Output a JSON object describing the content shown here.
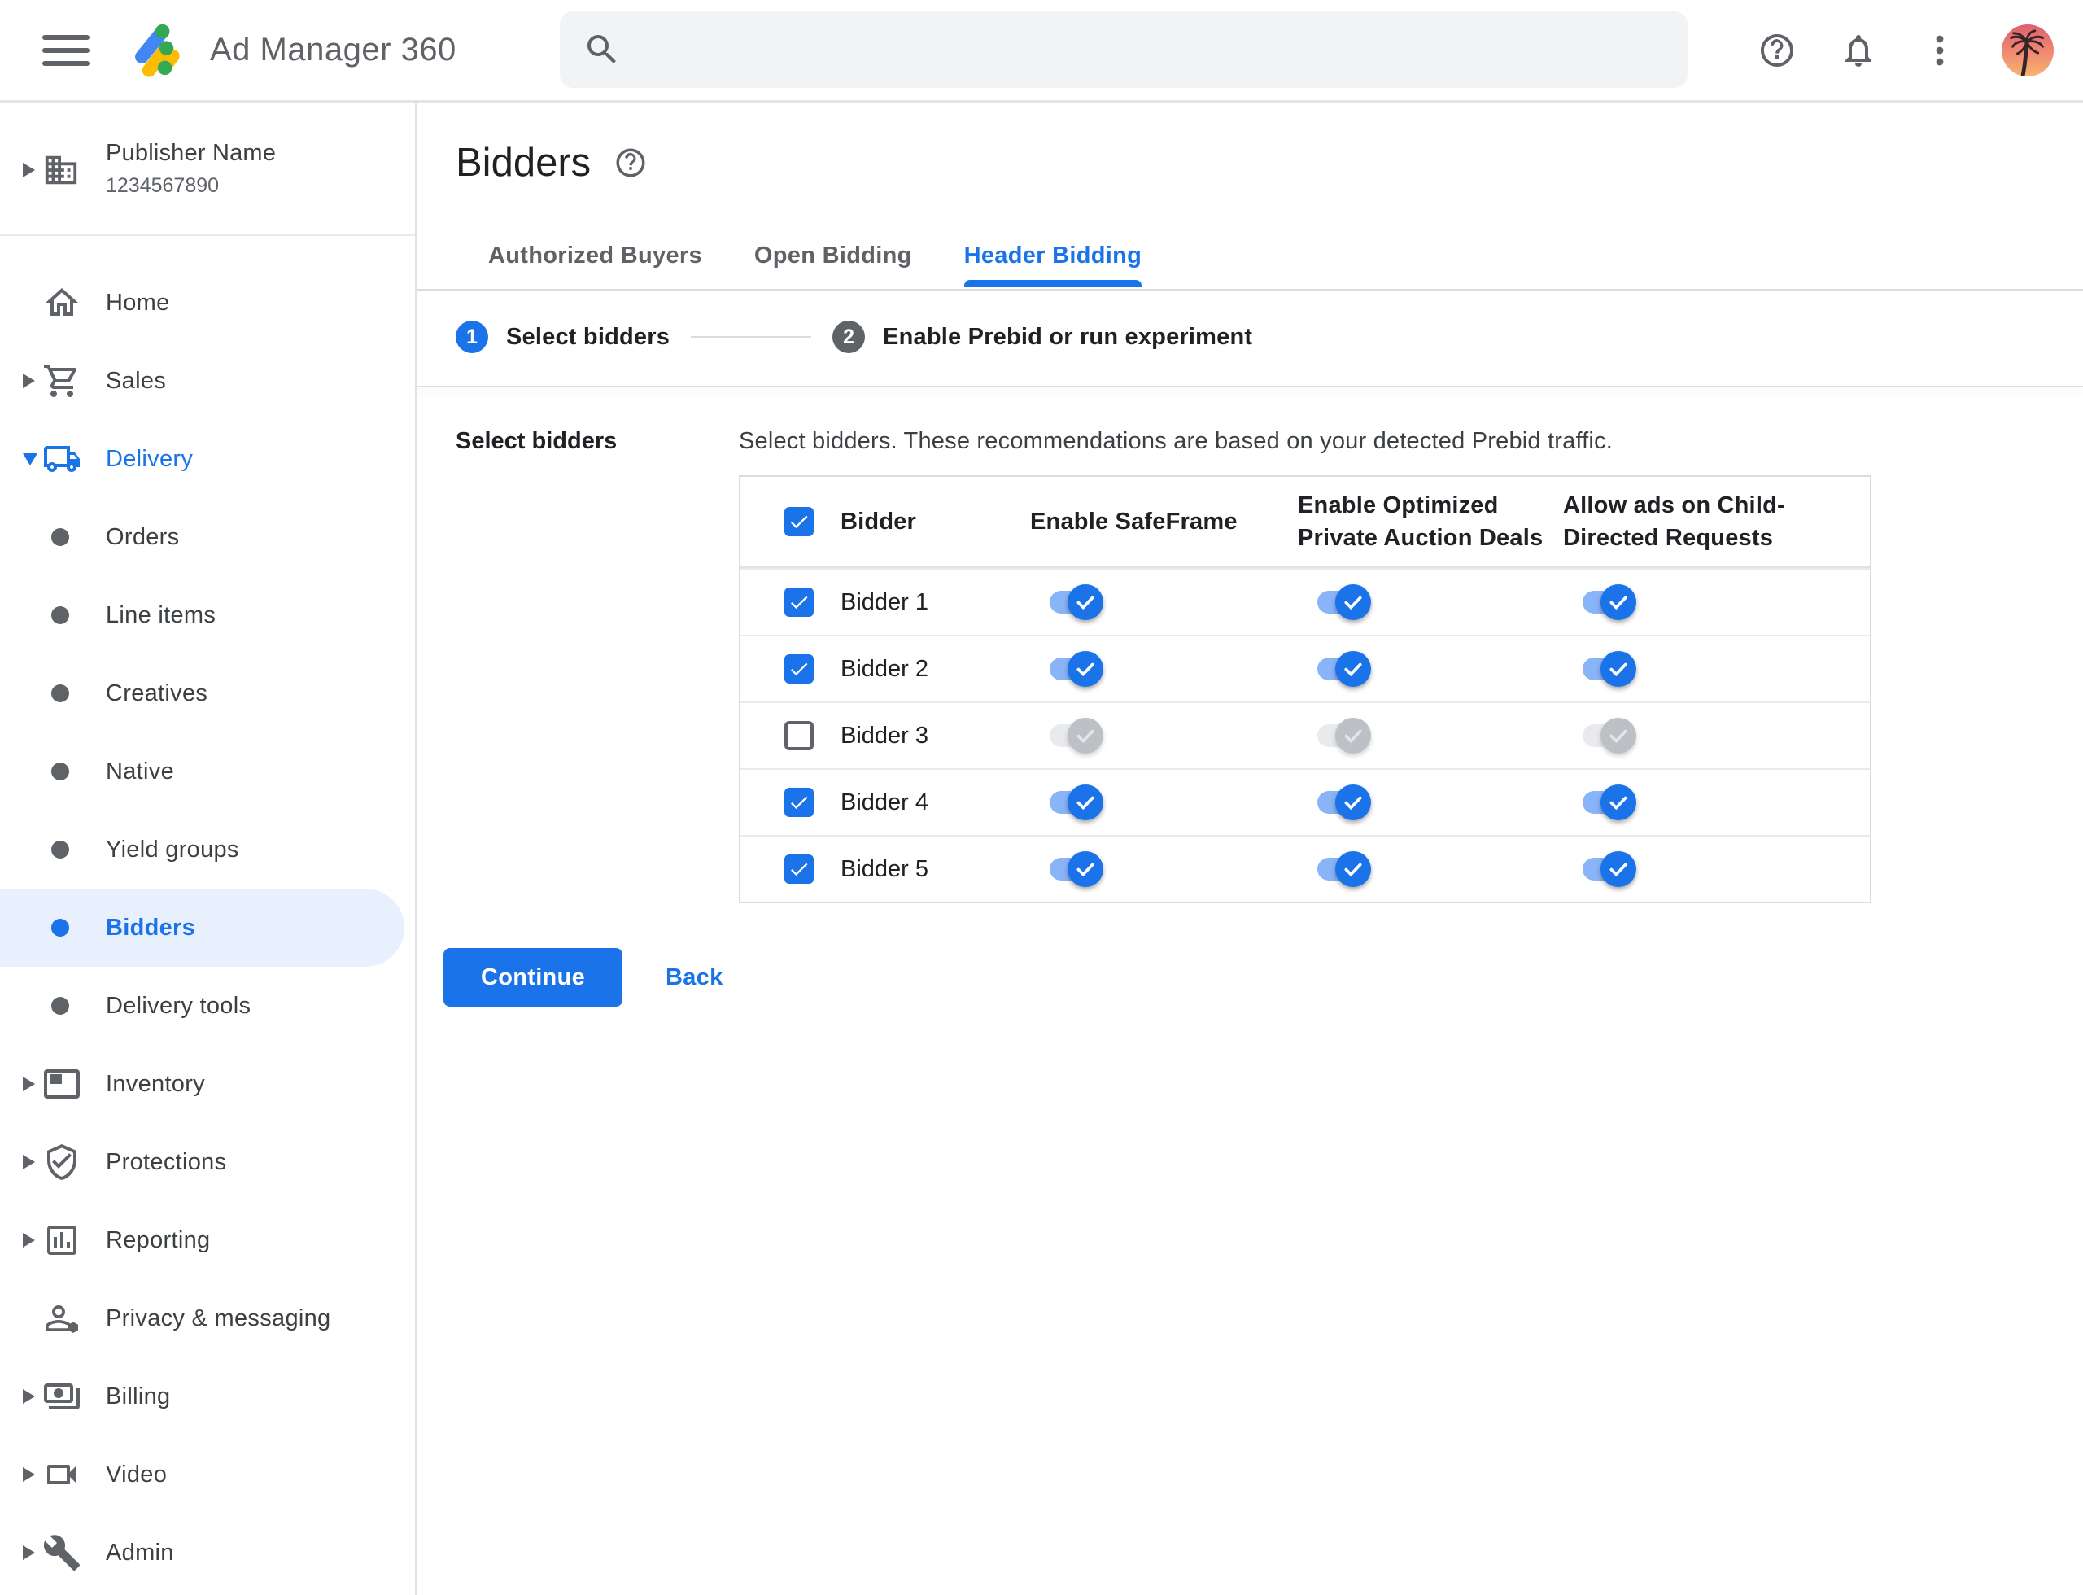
{
  "topbar": {
    "app_title": "Ad Manager 360",
    "search": {
      "value": "",
      "placeholder": ""
    }
  },
  "sidebar": {
    "publisher": {
      "name": "Publisher Name",
      "id": "1234567890"
    },
    "items": [
      {
        "label": "Home"
      },
      {
        "label": "Sales"
      },
      {
        "label": "Delivery",
        "expanded": true
      },
      {
        "label": "Orders",
        "sub": true
      },
      {
        "label": "Line items",
        "sub": true
      },
      {
        "label": "Creatives",
        "sub": true
      },
      {
        "label": "Native",
        "sub": true
      },
      {
        "label": "Yield groups",
        "sub": true
      },
      {
        "label": "Bidders",
        "sub": true,
        "selected": true
      },
      {
        "label": "Delivery tools",
        "sub": true
      },
      {
        "label": "Inventory"
      },
      {
        "label": "Protections"
      },
      {
        "label": "Reporting"
      },
      {
        "label": "Privacy & messaging"
      },
      {
        "label": "Billing"
      },
      {
        "label": "Video"
      },
      {
        "label": "Admin"
      }
    ]
  },
  "main": {
    "page_title": "Bidders",
    "tabs": [
      {
        "label": "Authorized Buyers",
        "active": false
      },
      {
        "label": "Open Bidding",
        "active": false
      },
      {
        "label": "Header Bidding",
        "active": true
      }
    ],
    "stepper": [
      {
        "number": "1",
        "label": "Select bidders",
        "active": true
      },
      {
        "number": "2",
        "label": "Enable Prebid or run experiment",
        "active": false
      }
    ],
    "section_label": "Select bidders",
    "description": "Select bidders. These recommendations are based on your detected Prebid traffic.",
    "table": {
      "select_all_checked": true,
      "columns": [
        "Bidder",
        "Enable SafeFrame",
        "Enable Optimized Private Auction Deals",
        "Allow ads on Child-Directed Requests"
      ],
      "rows": [
        {
          "name": "Bidder 1",
          "selected": true,
          "enable_safeframe": true,
          "enable_optimized_private_auction_deals": true,
          "allow_ads_on_child_directed_requests": true
        },
        {
          "name": "Bidder 2",
          "selected": true,
          "enable_safeframe": true,
          "enable_optimized_private_auction_deals": true,
          "allow_ads_on_child_directed_requests": true
        },
        {
          "name": "Bidder 3",
          "selected": false,
          "enable_safeframe": true,
          "enable_optimized_private_auction_deals": true,
          "allow_ads_on_child_directed_requests": true
        },
        {
          "name": "Bidder 4",
          "selected": true,
          "enable_safeframe": true,
          "enable_optimized_private_auction_deals": true,
          "allow_ads_on_child_directed_requests": true
        },
        {
          "name": "Bidder 5",
          "selected": true,
          "enable_safeframe": true,
          "enable_optimized_private_auction_deals": true,
          "allow_ads_on_child_directed_requests": true
        }
      ]
    },
    "actions": {
      "continue_label": "Continue",
      "back_label": "Back"
    }
  },
  "colors": {
    "accent_blue": "#1a73e8",
    "toggle_track_on": "#8ab4f8",
    "toggle_thumb_off": "#bdc1c6",
    "nav_selected_bg": "#e8f0fe",
    "brand_blue": "#4285f4",
    "brand_yellow": "#fbbc04",
    "brand_green": "#34a853"
  }
}
